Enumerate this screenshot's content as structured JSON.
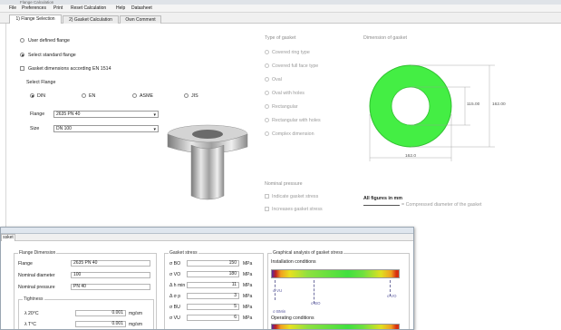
{
  "titlebar": {
    "left_text": "Flange Calculation",
    "right_text": ""
  },
  "menu": [
    "File",
    "Preferences",
    "Print",
    "Reset Calculation",
    "Help",
    "Datasheet"
  ],
  "tabs": [
    "1) Flange Selection",
    "2) Gasket Calculation",
    "Own Comment"
  ],
  "flange_source": {
    "user_defined": "User defined flange",
    "standard": "Select standard flange",
    "en1514": "Gasket dimensions according EN 1514"
  },
  "select_flange": {
    "title": "Select Flange",
    "standards": [
      "DIN",
      "EN",
      "ASME",
      "JIS"
    ],
    "flange_label": "Flange",
    "flange_value": "2635 PN 40",
    "size_label": "Size",
    "size_value": "DN 100"
  },
  "gasket_type": {
    "title": "Type of gasket",
    "options": [
      "Covered ring type",
      "Covered full face type",
      "Oval",
      "Oval with holes",
      "Rectangular",
      "Rectangular with holes",
      "Complex dimension"
    ]
  },
  "dimension": {
    "title": "Dimension of gasket",
    "inner": "115.00",
    "outer": "162.00",
    "width": "162.0",
    "note_bold": "All figures in mm",
    "note_grey": "= Compressed diameter of the gasket"
  },
  "nominal": {
    "title": "Nominal pressure",
    "options": [
      "Indicate gasket stress",
      "Increases gasket stress"
    ]
  },
  "colors": {
    "gasket_ring": "#44ee44",
    "accent": "#3070d0"
  },
  "overlay": {
    "tab": "ssket",
    "flange_dimension": {
      "title": "Flange Dimension",
      "rows": [
        {
          "label": "Flange",
          "value": "2635 PN 40"
        },
        {
          "label": "Nominal diameter",
          "value": "100"
        },
        {
          "label": "Nominal pressure",
          "value": "PN 40"
        }
      ],
      "tightness_title": "Tightness",
      "tightness": [
        {
          "label": "λ 20°C",
          "value": "0.001",
          "unit": "mg/sm"
        },
        {
          "label": "λ T°C",
          "value": "0.001",
          "unit": "mg/sm"
        }
      ]
    },
    "gasket_stress": {
      "title": "Gasket stress",
      "rows": [
        {
          "label": "σ BO",
          "value": "150",
          "unit": "MPa"
        },
        {
          "label": "σ VO",
          "value": "180",
          "unit": "MPa"
        },
        {
          "label": "Δ h min",
          "value": "11",
          "unit": "MPa"
        },
        {
          "label": "Δ σ p",
          "value": "3",
          "unit": "MPa"
        },
        {
          "label": "σ BU",
          "value": "5",
          "unit": "MPa"
        },
        {
          "label": "σ VU",
          "value": "6",
          "unit": "MPa"
        }
      ]
    },
    "graphical": {
      "title": "Graphical analysis of gasket stress",
      "installation": "Installation conditions",
      "operating": "Operating conditions",
      "markers": [
        "σ VU",
        "σ BO",
        "σ VO",
        "σ BMin"
      ]
    }
  }
}
